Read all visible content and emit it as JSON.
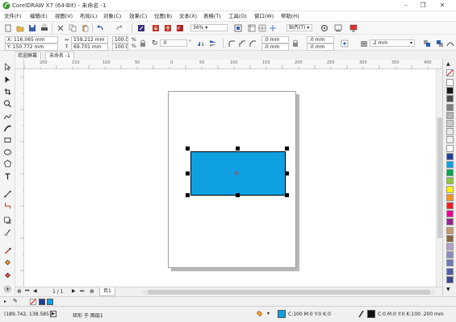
{
  "window": {
    "title": "CorelDRAW X7 (64-Bit) - 未命名 -1",
    "minimize": "–",
    "maximize": "❐",
    "close": "✕"
  },
  "menu": [
    "文件(F)",
    "编辑(E)",
    "视图(V)",
    "布局(L)",
    "对象(C)",
    "效果(C)",
    "位图(B)",
    "文本(X)",
    "表格(T)",
    "工具(O)",
    "窗口(W)",
    "帮助(H)"
  ],
  "toolbar": {
    "zoom": "36%",
    "snap_label": "贴齐(T)"
  },
  "property_bar": {
    "x": "X: 116.065 mm",
    "y": "Y: 150.772 mm",
    "width": "159.212 mm",
    "height": "69.701 mm",
    "scale_x": "100.0",
    "scale_y": "100.0",
    "percent": "%",
    "angle": ".0",
    "corner_top_left": ".0 mm",
    "corner_bottom_left": ".0 mm",
    "corner_top_right": ".0 mm",
    "corner_bottom_right": ".0 mm",
    "outline_width": ".2 mm"
  },
  "tabs": [
    "欢迎屏幕",
    "未命名 -1"
  ],
  "rulers": {
    "horizontal": [
      "200",
      "150",
      "100",
      "50",
      "0",
      "50",
      "100",
      "150",
      "200",
      "250",
      "300",
      "350",
      "400"
    ],
    "unit": "毫米"
  },
  "page_nav": {
    "counter": "1 / 1",
    "page_tab": "页1"
  },
  "status": {
    "coordinates": "(189.742, 138.585 )",
    "selection": "矩形 于 图层1",
    "fill": "C:100 M:0 Y:0 K:0",
    "outline": "C:0 M:0 Y:0 K:100 .200 mm"
  },
  "colors": {
    "rect_fill": "#0fa0e2",
    "palette": [
      "#ffffff",
      "#1a1a1a",
      "#4d4d4d",
      "#808080",
      "#b3b3b3",
      "#cccccc",
      "#e6e6e6",
      "#f2f2f2",
      "#ffffff",
      "#1f3f99",
      "#0fa0e2",
      "#00a651",
      "#8cc63f",
      "#fff200",
      "#f7941d",
      "#ed1c24",
      "#ec008c",
      "#92278f",
      "#c49a6c",
      "#8c6239",
      "#b0a2c8",
      "#8a8fbf",
      "#6d7ab8",
      "#4f5ea7",
      "#3b4a8c"
    ]
  }
}
